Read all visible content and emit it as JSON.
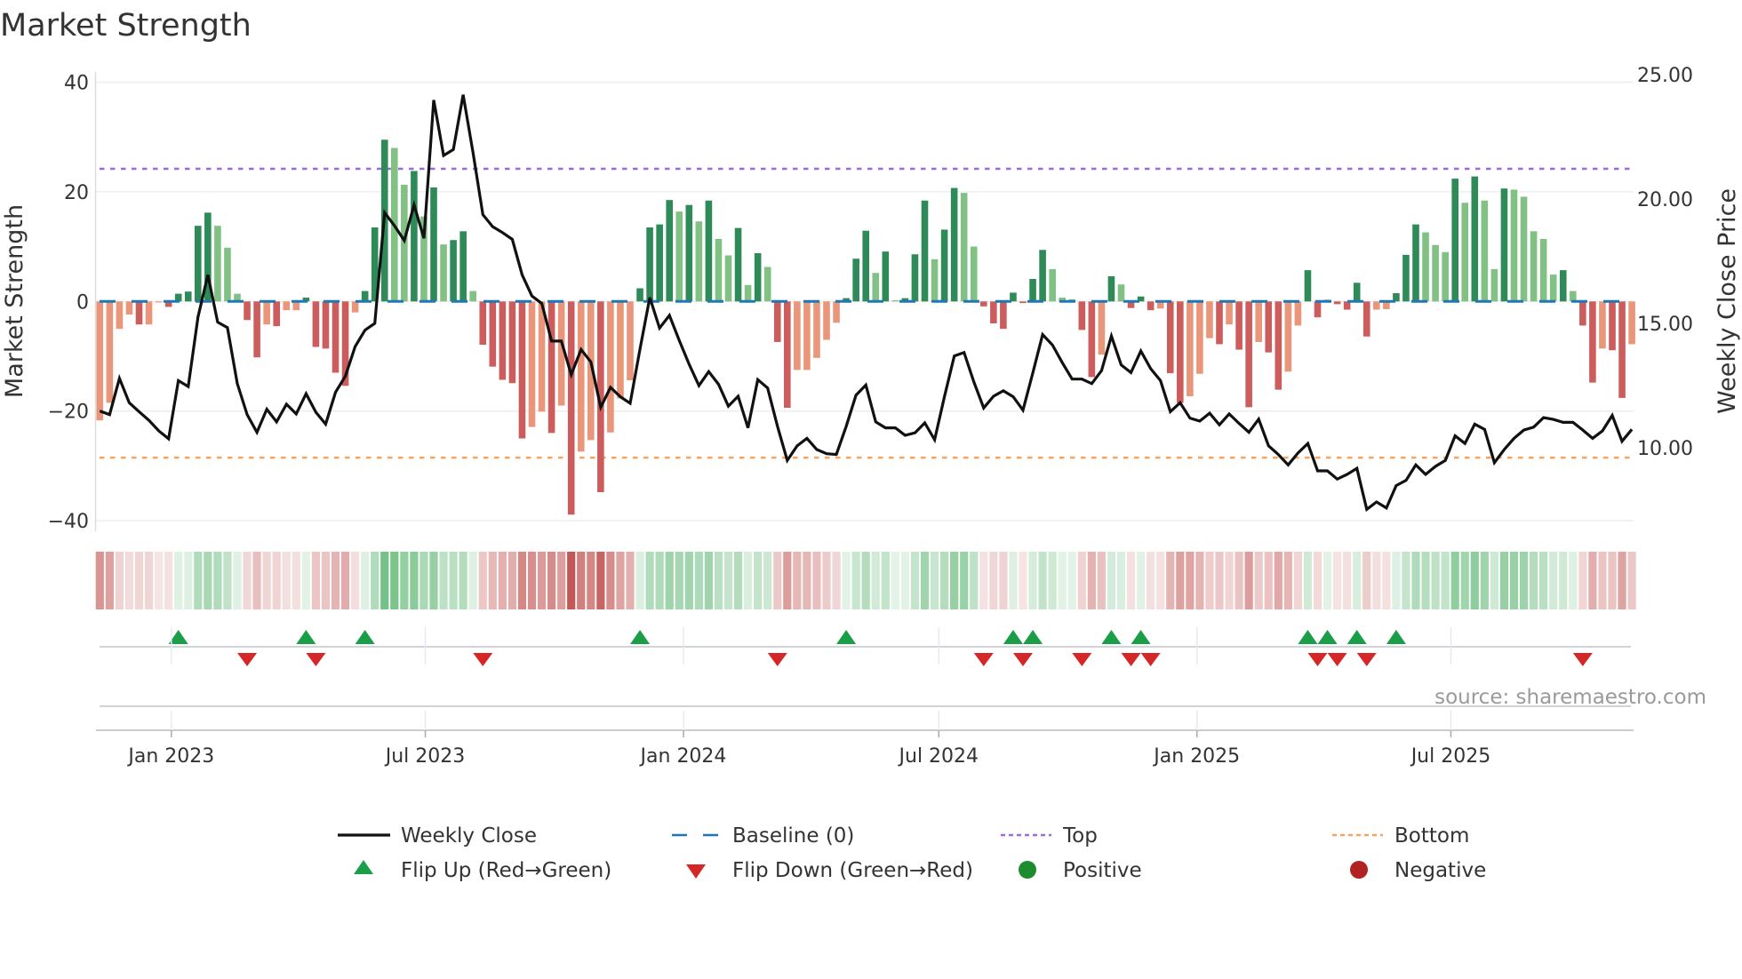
{
  "title": "Market Strength",
  "source": "source: sharemaestro.com",
  "colors": {
    "strength_up_positive": "#2e8b57",
    "strength_down_positive": "#81c184",
    "strength_down_negative": "#cd5c5c",
    "strength_up_negative": "#e9967a",
    "weekly_close": "#111111",
    "baseline": "#1f77b4",
    "top": "#9c6ada",
    "bottom": "#f4a460",
    "flip_up": "#1a9e47",
    "flip_down": "#d62728",
    "positive": "#1e8c2e",
    "negative": "#b22222",
    "heat_positive": "#4caf64",
    "heat_negative": "#c0504d"
  },
  "legend": [
    {
      "label": "Weekly Close",
      "symbol": "line-icon",
      "color": "#111111"
    },
    {
      "label": "Baseline (0)",
      "symbol": "dashed-line-icon",
      "color": "#1f77b4"
    },
    {
      "label": "Top",
      "symbol": "dotted-line-icon",
      "color": "#9c6ada"
    },
    {
      "label": "Bottom",
      "symbol": "dotted-line-icon",
      "color": "#f4a460"
    },
    {
      "label": "Flip Up (Red→Green)",
      "symbol": "triangle-up-icon",
      "color": "#1a9e47"
    },
    {
      "label": "Flip Down (Green→Red)",
      "symbol": "triangle-down-icon",
      "color": "#d62728"
    },
    {
      "label": "Positive",
      "symbol": "circle-icon",
      "color": "#1e8c2e"
    },
    {
      "label": "Negative",
      "symbol": "circle-icon",
      "color": "#b22222"
    }
  ],
  "chart_data": {
    "type": "bar+line",
    "title": "Market Strength",
    "ylabel": "Market Strength",
    "y2label": "Weekly Close Price",
    "ylim": [
      -42,
      42
    ],
    "y2lim": [
      6.64,
      25.1
    ],
    "grid": true,
    "legend_position": "bottom",
    "yticks": [
      {
        "value": 40,
        "label": "40"
      },
      {
        "value": 20,
        "label": "20"
      },
      {
        "value": 0,
        "label": "0"
      },
      {
        "value": -20,
        "label": "−20"
      },
      {
        "value": -40,
        "label": "−40"
      }
    ],
    "y2ticks": [
      {
        "value": 25,
        "label": "25.00"
      },
      {
        "value": 20,
        "label": "20.00"
      },
      {
        "value": 15,
        "label": "15.00"
      },
      {
        "value": 10,
        "label": "10.00"
      }
    ],
    "xticks": [
      {
        "date": "2023-01-01",
        "label": "Jan 2023"
      },
      {
        "date": "2023-07-01",
        "label": "Jul 2023"
      },
      {
        "date": "2024-01-01",
        "label": "Jan 2024"
      },
      {
        "date": "2024-07-01",
        "label": "Jul 2024"
      },
      {
        "date": "2025-01-01",
        "label": "Jan 2025"
      },
      {
        "date": "2025-07-01",
        "label": "Jul 2025"
      }
    ],
    "top_level": 24.2,
    "bottom_level": -28.5,
    "baseline": 0,
    "x": [
      "2022-11-11",
      "2022-11-18",
      "2022-11-25",
      "2022-12-02",
      "2022-12-09",
      "2022-12-16",
      "2022-12-23",
      "2022-12-30",
      "2023-01-06",
      "2023-01-13",
      "2023-01-20",
      "2023-01-27",
      "2023-02-03",
      "2023-02-10",
      "2023-02-17",
      "2023-02-24",
      "2023-03-03",
      "2023-03-10",
      "2023-03-17",
      "2023-03-24",
      "2023-03-31",
      "2023-04-07",
      "2023-04-14",
      "2023-04-21",
      "2023-04-28",
      "2023-05-05",
      "2023-05-12",
      "2023-05-19",
      "2023-05-26",
      "2023-06-02",
      "2023-06-09",
      "2023-06-16",
      "2023-06-23",
      "2023-06-30",
      "2023-07-07",
      "2023-07-14",
      "2023-07-21",
      "2023-07-28",
      "2023-08-04",
      "2023-08-11",
      "2023-08-18",
      "2023-08-25",
      "2023-09-01",
      "2023-09-08",
      "2023-09-15",
      "2023-09-22",
      "2023-09-29",
      "2023-10-06",
      "2023-10-13",
      "2023-10-20",
      "2023-10-27",
      "2023-11-03",
      "2023-11-10",
      "2023-11-17",
      "2023-11-24",
      "2023-12-01",
      "2023-12-08",
      "2023-12-15",
      "2023-12-22",
      "2023-12-29",
      "2024-01-05",
      "2024-01-12",
      "2024-01-19",
      "2024-01-26",
      "2024-02-02",
      "2024-02-09",
      "2024-02-16",
      "2024-02-23",
      "2024-03-01",
      "2024-03-08",
      "2024-03-15",
      "2024-03-22",
      "2024-03-29",
      "2024-04-05",
      "2024-04-12",
      "2024-04-19",
      "2024-04-26",
      "2024-05-03",
      "2024-05-10",
      "2024-05-17",
      "2024-05-24",
      "2024-05-31",
      "2024-06-07",
      "2024-06-14",
      "2024-06-21",
      "2024-06-28",
      "2024-07-05",
      "2024-07-12",
      "2024-07-19",
      "2024-07-26",
      "2024-08-02",
      "2024-08-09",
      "2024-08-16",
      "2024-08-23",
      "2024-08-30",
      "2024-09-06",
      "2024-09-13",
      "2024-09-20",
      "2024-09-27",
      "2024-10-04",
      "2024-10-11",
      "2024-10-18",
      "2024-10-25",
      "2024-11-01",
      "2024-11-08",
      "2024-11-15",
      "2024-11-22",
      "2024-11-29",
      "2024-12-06",
      "2024-12-13",
      "2024-12-20",
      "2024-12-27",
      "2025-01-03",
      "2025-01-10",
      "2025-01-17",
      "2025-01-24",
      "2025-01-31",
      "2025-02-07",
      "2025-02-14",
      "2025-02-21",
      "2025-02-28",
      "2025-03-07",
      "2025-03-14",
      "2025-03-21",
      "2025-03-28",
      "2025-04-04",
      "2025-04-11",
      "2025-04-18",
      "2025-04-25",
      "2025-05-02",
      "2025-05-09",
      "2025-05-16",
      "2025-05-23",
      "2025-05-30",
      "2025-06-06",
      "2025-06-13",
      "2025-06-20",
      "2025-06-27",
      "2025-07-04",
      "2025-07-11",
      "2025-07-18",
      "2025-07-25",
      "2025-08-01",
      "2025-08-08",
      "2025-08-15",
      "2025-08-22",
      "2025-08-29",
      "2025-09-05",
      "2025-09-12",
      "2025-09-19",
      "2025-09-26",
      "2025-10-03",
      "2025-10-10",
      "2025-10-17",
      "2025-10-24",
      "2025-10-31",
      "2025-11-07"
    ],
    "strength": [
      -21.7,
      -18.5,
      -5,
      -2.4,
      -4.2,
      -4.2,
      -0.2,
      -1,
      1.4,
      1.8,
      13.8,
      16.2,
      13.8,
      9.8,
      1.4,
      -3.4,
      -10.2,
      -4.2,
      -4.5,
      -1.6,
      -1.6,
      0.7,
      -8.3,
      -8.6,
      -13,
      -15.4,
      -2,
      1.9,
      13.5,
      29.5,
      28,
      21.3,
      23.8,
      15.5,
      20.8,
      10.4,
      11.2,
      12.8,
      1.9,
      -7.9,
      -11.9,
      -14.3,
      -14.9,
      -25,
      -22.9,
      -20.1,
      -24,
      -19,
      -38.9,
      -27.4,
      -25.3,
      -34.8,
      -23.9,
      -17.7,
      -14.4,
      2.4,
      13.5,
      14.05,
      18.5,
      16.4,
      17.6,
      14.6,
      18.4,
      11.4,
      8.4,
      13.4,
      3,
      8.8,
      6.3,
      -7.4,
      -19.4,
      -12.5,
      -12.5,
      -10.3,
      -7,
      -3.9,
      0.6,
      7.8,
      12.9,
      5.2,
      9.1,
      0.2,
      0.6,
      8.6,
      18.4,
      7.7,
      13.1,
      20.7,
      19.8,
      10,
      -0.9,
      -4,
      -5,
      1.6,
      -0.3,
      4.1,
      9.4,
      5.9,
      0.7,
      0.4,
      -5.2,
      -13.8,
      -9.7,
      4.6,
      3.1,
      -1.2,
      0.9,
      -1.6,
      -1.3,
      -13.1,
      -18.5,
      -17.3,
      -13.2,
      -6.7,
      -7.8,
      -4.2,
      -8.8,
      -19.3,
      -7.4,
      -9.3,
      -16.1,
      -12.8,
      -4.4,
      5.7,
      -2.9,
      0.3,
      -0.5,
      -1.5,
      3.4,
      -6.4,
      -1.5,
      -1.4,
      1.5,
      8.5,
      14.05,
      12.6,
      10.3,
      9,
      22.4,
      18,
      22.8,
      18.4,
      5.9,
      20.6,
      20.4,
      19.1,
      12.8,
      11.4,
      4.9,
      5.7,
      1.9,
      -4.4,
      -14.8,
      -8.6,
      -8.9,
      -17.6,
      -7.8
    ],
    "weekly_close": {
      "name": "Weekly Close",
      "values": [
        11.48,
        11.33,
        12.79,
        11.81,
        11.45,
        11.1,
        10.68,
        10.36,
        12.7,
        12.46,
        15.26,
        16.95,
        15.05,
        14.83,
        12.58,
        11.33,
        10.62,
        11.55,
        11.04,
        11.75,
        11.36,
        12.17,
        11.43,
        10.95,
        12.23,
        12.88,
        14.07,
        14.73,
        15.0,
        19.45,
        18.93,
        18.33,
        19.76,
        18.42,
        23.98,
        21.75,
        21.99,
        24.19,
        21.87,
        19.37,
        18.89,
        18.65,
        18.38,
        16.95,
        16.1,
        15.8,
        14.29,
        14.29,
        12.94,
        13.95,
        13.45,
        11.63,
        12.43,
        12.05,
        11.79,
        13.95,
        16.04,
        14.81,
        15.32,
        14.31,
        13.36,
        12.5,
        13.06,
        12.55,
        11.67,
        12.07,
        10.8,
        12.74,
        12.4,
        10.86,
        9.49,
        10.08,
        10.38,
        9.93,
        9.76,
        9.73,
        10.86,
        12.11,
        12.52,
        11.04,
        10.8,
        10.8,
        10.5,
        10.6,
        11.0,
        10.32,
        12.05,
        13.69,
        13.83,
        12.64,
        11.6,
        12.07,
        12.29,
        12.05,
        11.51,
        13.0,
        14.55,
        14.13,
        13.42,
        12.76,
        12.76,
        12.58,
        13.1,
        14.49,
        13.33,
        13.02,
        13.89,
        13.18,
        12.7,
        11.45,
        11.81,
        11.19,
        11.07,
        11.39,
        10.92,
        11.36,
        10.98,
        10.62,
        11.15,
        10.08,
        9.73,
        9.31,
        9.79,
        10.17,
        9.07,
        9.07,
        8.74,
        8.93,
        9.17,
        7.52,
        7.82,
        7.58,
        8.48,
        8.69,
        9.31,
        8.93,
        9.25,
        9.49,
        10.48,
        10.17,
        10.95,
        10.74,
        9.4,
        9.93,
        10.38,
        10.71,
        10.83,
        11.21,
        11.14,
        11.02,
        11.02,
        10.71,
        10.38,
        10.68,
        11.3,
        10.26,
        10.74
      ]
    },
    "flip_up": [
      "2023-01-06",
      "2023-04-07",
      "2023-05-19",
      "2023-12-01",
      "2024-04-26",
      "2024-08-23",
      "2024-09-06",
      "2024-11-01",
      "2024-11-22",
      "2025-03-21",
      "2025-04-04",
      "2025-04-25",
      "2025-05-23"
    ],
    "flip_down": [
      "2023-02-24",
      "2023-04-14",
      "2023-08-11",
      "2024-03-08",
      "2024-08-02",
      "2024-08-30",
      "2024-10-11",
      "2024-11-15",
      "2024-11-29",
      "2025-03-28",
      "2025-04-11",
      "2025-05-02",
      "2025-10-03"
    ],
    "positive_points": [],
    "negative_points": []
  }
}
